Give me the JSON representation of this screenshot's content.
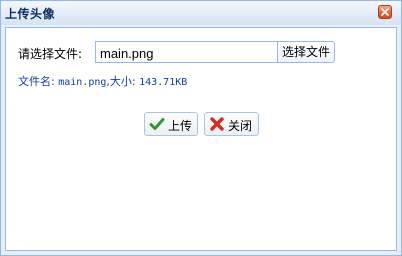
{
  "dialog": {
    "title": "上传头像",
    "close_icon": "close-icon"
  },
  "form": {
    "file_label": "请选择文件:",
    "file_value": "main.png",
    "choose_button": "选择文件",
    "info_prefix": "文件名:",
    "info_filename": "main.png",
    "info_size_label": ",大小:",
    "info_size": "143.71KB"
  },
  "actions": {
    "upload_label": "上传",
    "upload_icon": "checkmark-icon",
    "close_label": "关闭",
    "close_icon": "red-x-icon"
  },
  "colors": {
    "title_text": "#0e2d5f",
    "info_text": "#0f3ea6",
    "border": "#95b8e7",
    "check_green": "#2e9a2e",
    "x_red": "#d62a1f"
  }
}
